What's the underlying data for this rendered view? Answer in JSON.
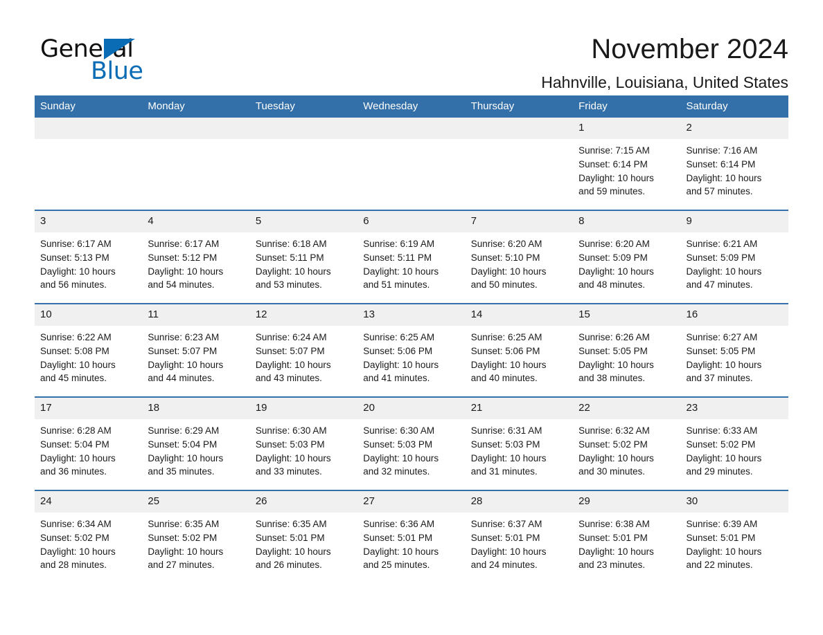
{
  "brand": {
    "name_part1": "General",
    "name_part2": "Blue",
    "accent_color": "#0a6cb4"
  },
  "header": {
    "title": "November 2024",
    "subtitle": "Hahnville, Louisiana, United States",
    "header_bg_color": "#336fa9",
    "daynum_bg_color": "#f0f0f0"
  },
  "weekday_headers": [
    "Sunday",
    "Monday",
    "Tuesday",
    "Wednesday",
    "Thursday",
    "Friday",
    "Saturday"
  ],
  "labels": {
    "sunrise": "Sunrise:",
    "sunset": "Sunset:",
    "daylight": "Daylight:"
  },
  "weeks": [
    [
      {
        "day": "",
        "lines": [
          "",
          "",
          "",
          ""
        ]
      },
      {
        "day": "",
        "lines": [
          "",
          "",
          "",
          ""
        ]
      },
      {
        "day": "",
        "lines": [
          "",
          "",
          "",
          ""
        ]
      },
      {
        "day": "",
        "lines": [
          "",
          "",
          "",
          ""
        ]
      },
      {
        "day": "",
        "lines": [
          "",
          "",
          "",
          ""
        ]
      },
      {
        "day": "1",
        "lines": [
          "Sunrise: 7:15 AM",
          "Sunset: 6:14 PM",
          "Daylight: 10 hours",
          "and 59 minutes."
        ]
      },
      {
        "day": "2",
        "lines": [
          "Sunrise: 7:16 AM",
          "Sunset: 6:14 PM",
          "Daylight: 10 hours",
          "and 57 minutes."
        ]
      }
    ],
    [
      {
        "day": "3",
        "lines": [
          "Sunrise: 6:17 AM",
          "Sunset: 5:13 PM",
          "Daylight: 10 hours",
          "and 56 minutes."
        ]
      },
      {
        "day": "4",
        "lines": [
          "Sunrise: 6:17 AM",
          "Sunset: 5:12 PM",
          "Daylight: 10 hours",
          "and 54 minutes."
        ]
      },
      {
        "day": "5",
        "lines": [
          "Sunrise: 6:18 AM",
          "Sunset: 5:11 PM",
          "Daylight: 10 hours",
          "and 53 minutes."
        ]
      },
      {
        "day": "6",
        "lines": [
          "Sunrise: 6:19 AM",
          "Sunset: 5:11 PM",
          "Daylight: 10 hours",
          "and 51 minutes."
        ]
      },
      {
        "day": "7",
        "lines": [
          "Sunrise: 6:20 AM",
          "Sunset: 5:10 PM",
          "Daylight: 10 hours",
          "and 50 minutes."
        ]
      },
      {
        "day": "8",
        "lines": [
          "Sunrise: 6:20 AM",
          "Sunset: 5:09 PM",
          "Daylight: 10 hours",
          "and 48 minutes."
        ]
      },
      {
        "day": "9",
        "lines": [
          "Sunrise: 6:21 AM",
          "Sunset: 5:09 PM",
          "Daylight: 10 hours",
          "and 47 minutes."
        ]
      }
    ],
    [
      {
        "day": "10",
        "lines": [
          "Sunrise: 6:22 AM",
          "Sunset: 5:08 PM",
          "Daylight: 10 hours",
          "and 45 minutes."
        ]
      },
      {
        "day": "11",
        "lines": [
          "Sunrise: 6:23 AM",
          "Sunset: 5:07 PM",
          "Daylight: 10 hours",
          "and 44 minutes."
        ]
      },
      {
        "day": "12",
        "lines": [
          "Sunrise: 6:24 AM",
          "Sunset: 5:07 PM",
          "Daylight: 10 hours",
          "and 43 minutes."
        ]
      },
      {
        "day": "13",
        "lines": [
          "Sunrise: 6:25 AM",
          "Sunset: 5:06 PM",
          "Daylight: 10 hours",
          "and 41 minutes."
        ]
      },
      {
        "day": "14",
        "lines": [
          "Sunrise: 6:25 AM",
          "Sunset: 5:06 PM",
          "Daylight: 10 hours",
          "and 40 minutes."
        ]
      },
      {
        "day": "15",
        "lines": [
          "Sunrise: 6:26 AM",
          "Sunset: 5:05 PM",
          "Daylight: 10 hours",
          "and 38 minutes."
        ]
      },
      {
        "day": "16",
        "lines": [
          "Sunrise: 6:27 AM",
          "Sunset: 5:05 PM",
          "Daylight: 10 hours",
          "and 37 minutes."
        ]
      }
    ],
    [
      {
        "day": "17",
        "lines": [
          "Sunrise: 6:28 AM",
          "Sunset: 5:04 PM",
          "Daylight: 10 hours",
          "and 36 minutes."
        ]
      },
      {
        "day": "18",
        "lines": [
          "Sunrise: 6:29 AM",
          "Sunset: 5:04 PM",
          "Daylight: 10 hours",
          "and 35 minutes."
        ]
      },
      {
        "day": "19",
        "lines": [
          "Sunrise: 6:30 AM",
          "Sunset: 5:03 PM",
          "Daylight: 10 hours",
          "and 33 minutes."
        ]
      },
      {
        "day": "20",
        "lines": [
          "Sunrise: 6:30 AM",
          "Sunset: 5:03 PM",
          "Daylight: 10 hours",
          "and 32 minutes."
        ]
      },
      {
        "day": "21",
        "lines": [
          "Sunrise: 6:31 AM",
          "Sunset: 5:03 PM",
          "Daylight: 10 hours",
          "and 31 minutes."
        ]
      },
      {
        "day": "22",
        "lines": [
          "Sunrise: 6:32 AM",
          "Sunset: 5:02 PM",
          "Daylight: 10 hours",
          "and 30 minutes."
        ]
      },
      {
        "day": "23",
        "lines": [
          "Sunrise: 6:33 AM",
          "Sunset: 5:02 PM",
          "Daylight: 10 hours",
          "and 29 minutes."
        ]
      }
    ],
    [
      {
        "day": "24",
        "lines": [
          "Sunrise: 6:34 AM",
          "Sunset: 5:02 PM",
          "Daylight: 10 hours",
          "and 28 minutes."
        ]
      },
      {
        "day": "25",
        "lines": [
          "Sunrise: 6:35 AM",
          "Sunset: 5:02 PM",
          "Daylight: 10 hours",
          "and 27 minutes."
        ]
      },
      {
        "day": "26",
        "lines": [
          "Sunrise: 6:35 AM",
          "Sunset: 5:01 PM",
          "Daylight: 10 hours",
          "and 26 minutes."
        ]
      },
      {
        "day": "27",
        "lines": [
          "Sunrise: 6:36 AM",
          "Sunset: 5:01 PM",
          "Daylight: 10 hours",
          "and 25 minutes."
        ]
      },
      {
        "day": "28",
        "lines": [
          "Sunrise: 6:37 AM",
          "Sunset: 5:01 PM",
          "Daylight: 10 hours",
          "and 24 minutes."
        ]
      },
      {
        "day": "29",
        "lines": [
          "Sunrise: 6:38 AM",
          "Sunset: 5:01 PM",
          "Daylight: 10 hours",
          "and 23 minutes."
        ]
      },
      {
        "day": "30",
        "lines": [
          "Sunrise: 6:39 AM",
          "Sunset: 5:01 PM",
          "Daylight: 10 hours",
          "and 22 minutes."
        ]
      }
    ]
  ]
}
